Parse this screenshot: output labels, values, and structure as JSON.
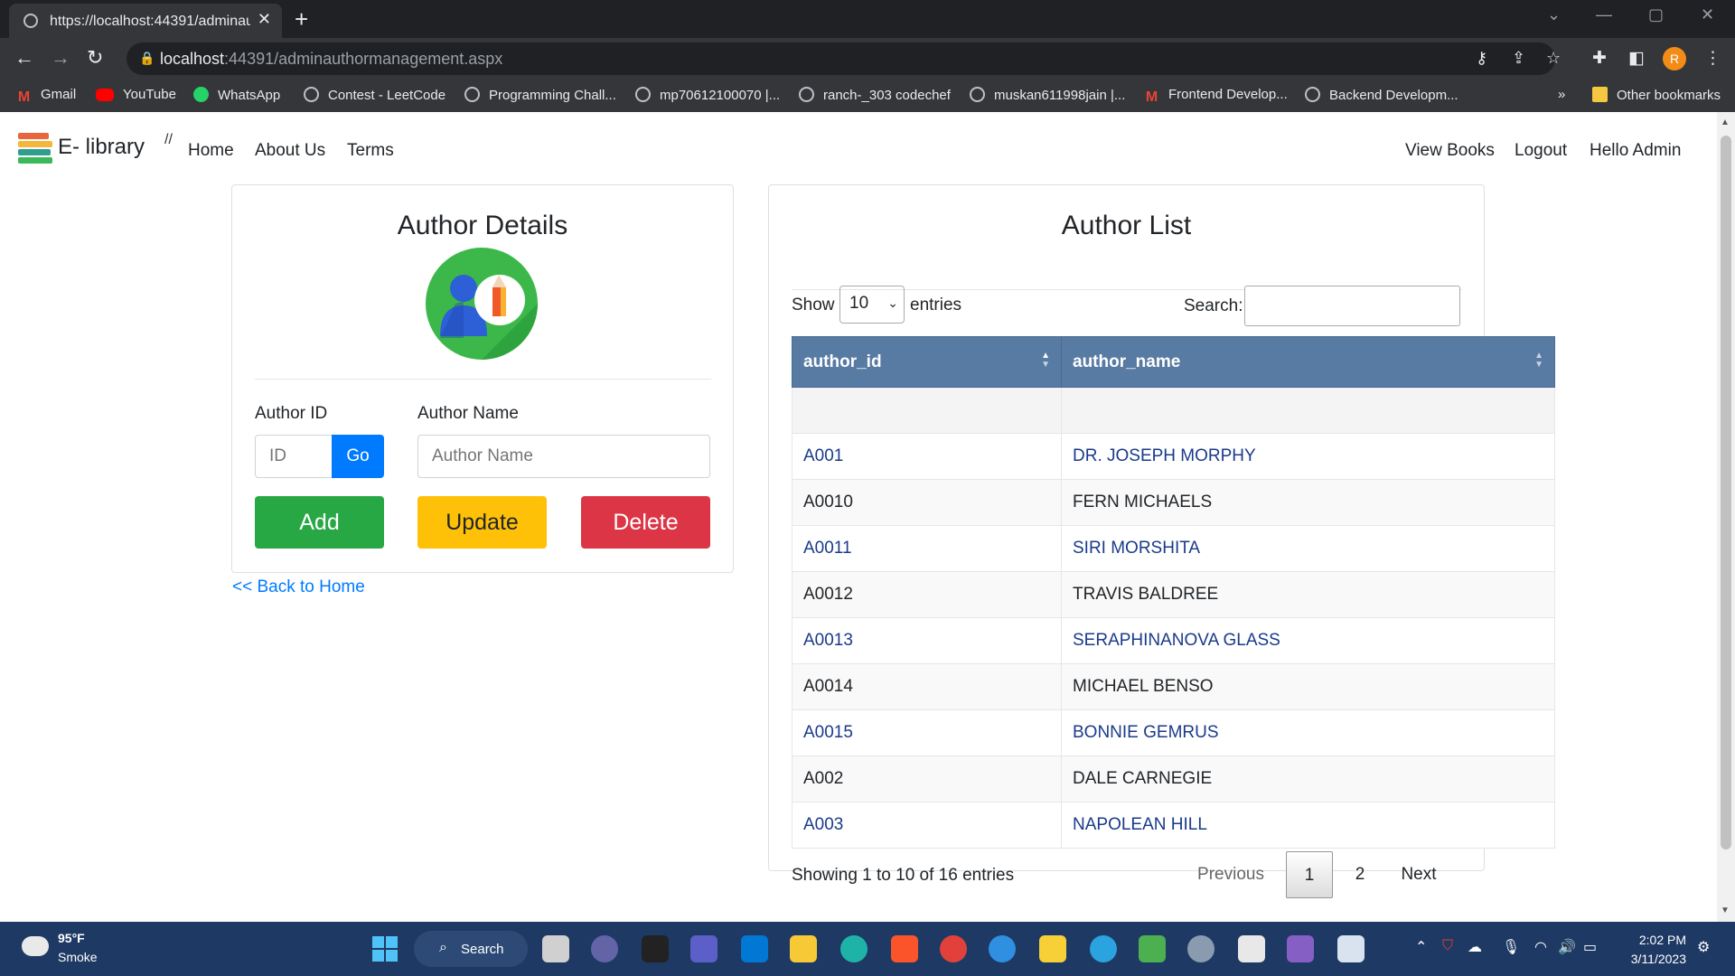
{
  "browser": {
    "tab_title": "https://localhost:44391/adminaut",
    "tab_close": "✕",
    "new_tab": "+",
    "url_host": "localhost",
    "url_path": ":44391/adminauthormanagement.aspx",
    "profile_initial": "R",
    "bookmarks": [
      {
        "label": "Gmail",
        "icon": "gmail-icon"
      },
      {
        "label": "YouTube",
        "icon": "youtube-icon"
      },
      {
        "label": "WhatsApp",
        "icon": "whatsapp-icon"
      },
      {
        "label": "Contest - LeetCode",
        "icon": "globe-icon"
      },
      {
        "label": "Programming Chall...",
        "icon": "globe-icon"
      },
      {
        "label": "mp70612100070 |...",
        "icon": "globe-icon"
      },
      {
        "label": "ranch-_303 codechef",
        "icon": "globe-icon"
      },
      {
        "label": "muskan611998jain |...",
        "icon": "globe-icon"
      },
      {
        "label": "Frontend Develop...",
        "icon": "gmail-icon"
      },
      {
        "label": "Backend Developm...",
        "icon": "globe-icon"
      }
    ],
    "bookmarks_overflow": "»",
    "other_bookmarks": "Other bookmarks"
  },
  "navbar": {
    "brand": "E- library",
    "separator": "//",
    "links": [
      "Home",
      "About Us",
      "Terms"
    ],
    "right_links": [
      "View Books",
      "Logout",
      "Hello Admin"
    ]
  },
  "author_details": {
    "title": "Author Details",
    "id_label": "Author ID",
    "id_placeholder": "ID",
    "go_label": "Go",
    "name_label": "Author Name",
    "name_placeholder": "Author Name",
    "add_label": "Add",
    "update_label": "Update",
    "delete_label": "Delete",
    "back_link": "<< Back to Home"
  },
  "author_list": {
    "title": "Author List",
    "show_label": "Show",
    "entries_value": "10",
    "entries_label": "entries",
    "search_label": "Search:",
    "columns": [
      "author_id",
      "author_name"
    ],
    "rows": [
      {
        "id": "",
        "name": ""
      },
      {
        "id": "A001",
        "name": "DR. JOSEPH MORPHY"
      },
      {
        "id": "A0010",
        "name": "FERN MICHAELS"
      },
      {
        "id": "A0011",
        "name": "SIRI MORSHITA"
      },
      {
        "id": "A0012",
        "name": "TRAVIS BALDREE"
      },
      {
        "id": "A0013",
        "name": "SERAPHINANOVA GLASS"
      },
      {
        "id": "A0014",
        "name": "MICHAEL BENSO"
      },
      {
        "id": "A0015",
        "name": "BONNIE GEMRUS"
      },
      {
        "id": "A002",
        "name": "DALE CARNEGIE"
      },
      {
        "id": "A003",
        "name": "NAPOLEAN HILL"
      }
    ],
    "info": "Showing 1 to 10 of 16 entries",
    "pagination": {
      "previous": "Previous",
      "pages": [
        "1",
        "2"
      ],
      "current": "1",
      "next": "Next"
    }
  },
  "taskbar": {
    "temperature": "95°F",
    "condition": "Smoke",
    "search_label": "Search",
    "time": "2:02 PM",
    "date": "3/11/2023"
  },
  "colors": {
    "table_header": "#587ba3",
    "add": "#28a745",
    "update": "#ffc107",
    "delete": "#dc3545",
    "link": "#007bff",
    "taskbar": "#1e3a64"
  }
}
